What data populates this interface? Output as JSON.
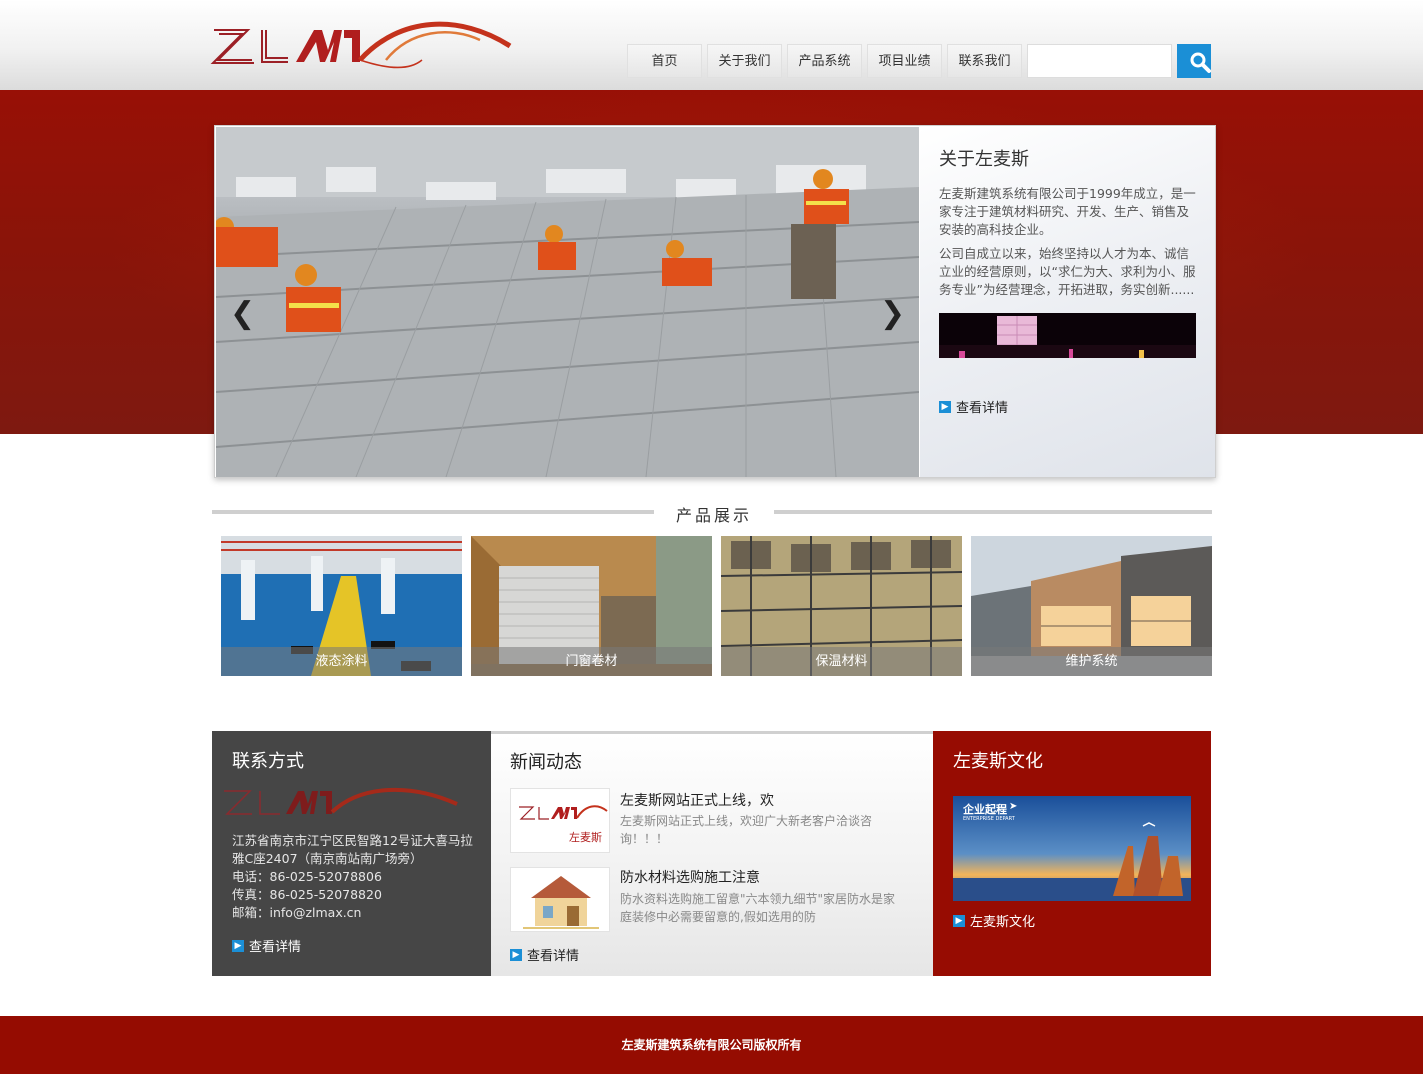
{
  "nav": {
    "items": [
      "首页",
      "关于我们",
      "产品系统",
      "项目业绩",
      "联系我们"
    ]
  },
  "search": {
    "placeholder": "",
    "value": ""
  },
  "banner": {
    "about_title": "关于左麦斯",
    "about_p1": "左麦斯建筑系统有限公司于1999年成立，是一家专注于建筑材料研究、开发、生产、销售及安装的高科技企业。",
    "about_p2": "公司自成立以来，始终坚持以人才为本、诚信立业的经营原则，以“求仁为大、求利为小、服务专业”为经营理念，开拓进取，务实创新......",
    "more": "查看详情"
  },
  "products": {
    "title": "产品展示",
    "items": [
      "液态涂料",
      "门窗卷材",
      "保温材料",
      "维护系统"
    ]
  },
  "contact": {
    "title": "联系方式",
    "address": "江苏省南京市江宁区民智路12号证大喜马拉雅C座2407（南京南站南广场旁）",
    "phone": "电话：86-025-52078806",
    "fax": "传真：86-025-52078820",
    "email": "邮箱：info@zlmax.cn",
    "more": "查看详情"
  },
  "news": {
    "title": "新闻动态",
    "items": [
      {
        "title": "左麦斯网站正式上线，欢",
        "desc": "左麦斯网站正式上线，欢迎广大新老客户洽谈咨询！！！",
        "thumb_text": "左麦斯"
      },
      {
        "title": "防水材料选购施工注意",
        "desc": "防水资料选购施工留意\"六本领九细节\"家居防水是家庭装修中必需要留意的,假如选用的防"
      }
    ],
    "more": "查看详情"
  },
  "culture": {
    "title": "左麦斯文化",
    "image_text": "企业起程",
    "image_subtext": "ENTERPRISE DEPART",
    "link": "左麦斯文化"
  },
  "footer": {
    "copyright": "左麦斯建筑系统有限公司版权所有"
  },
  "colors": {
    "brand_red": "#970c02",
    "accent_blue": "#1b8fd6",
    "dark_box": "#464646"
  }
}
